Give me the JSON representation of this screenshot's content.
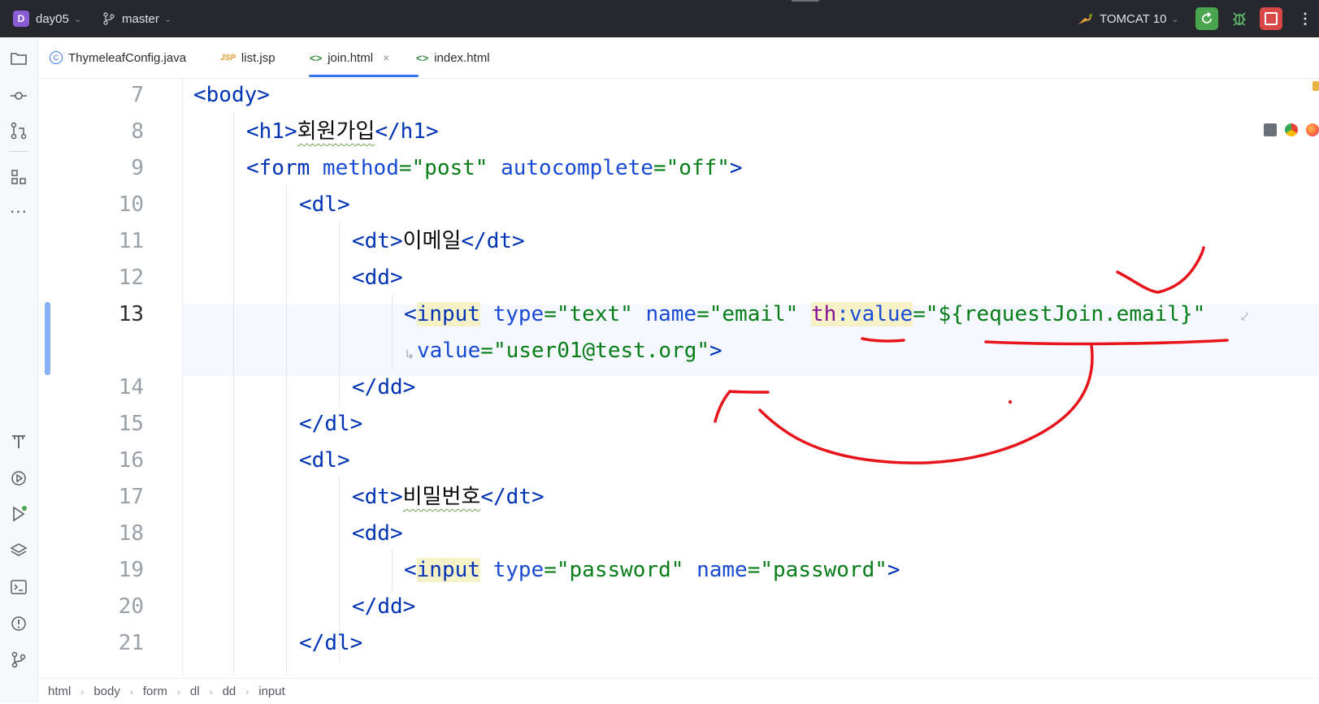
{
  "titlebar": {
    "project_badge": "D",
    "project_name": "day05",
    "branch": "master",
    "run_config": "TOMCAT 10",
    "colors": {
      "background": "#27282e",
      "run_green": "#4aa54f",
      "stop_red": "#d94848"
    }
  },
  "tabs": [
    {
      "label": "ThymeleafConfig.java",
      "icon": "java-class-icon"
    },
    {
      "label": "list.jsp",
      "icon": "jsp-file-icon",
      "icon_text": "JSP"
    },
    {
      "label": "join.html",
      "icon": "html-file-icon",
      "icon_text": "<>",
      "active": true,
      "close": "×"
    },
    {
      "label": "index.html",
      "icon": "html-file-icon",
      "icon_text": "<>"
    }
  ],
  "editor": {
    "current_line": 13,
    "lines": [
      {
        "number": "7"
      },
      {
        "number": "8"
      },
      {
        "number": "9"
      },
      {
        "number": "10"
      },
      {
        "number": "11"
      },
      {
        "number": "12"
      },
      {
        "number": "13"
      },
      {
        "number": ""
      },
      {
        "number": "14"
      },
      {
        "number": "15"
      },
      {
        "number": "16"
      },
      {
        "number": "17"
      },
      {
        "number": "18"
      },
      {
        "number": "19"
      },
      {
        "number": "20"
      },
      {
        "number": "21"
      }
    ],
    "code": {
      "l7_open": "<",
      "l7_tag": "body",
      "l7_close": ">",
      "l8_open": "<",
      "l8_tag": "h1",
      "l8_gt": ">",
      "l8_text": "회원가입",
      "l8_end_open": "</",
      "l8_end_tag": "h1",
      "l8_end_close": ">",
      "l9_open": "<",
      "l9_tag": "form",
      "l9_a1": " method",
      "l9_eq1": "=",
      "l9_v1": "\"post\"",
      "l9_a2": " autocomplete",
      "l9_eq2": "=",
      "l9_v2": "\"off\"",
      "l9_close": ">",
      "l10_open": "<",
      "l10_tag": "dl",
      "l10_close": ">",
      "l11_open": "<",
      "l11_tag": "dt",
      "l11_gt": ">",
      "l11_text": "이메일",
      "l11_end_open": "</",
      "l11_end_tag": "dt",
      "l11_end_close": ">",
      "l12_open": "<",
      "l12_tag": "dd",
      "l12_close": ">",
      "l13_open": "<",
      "l13_tag": "input",
      "l13_a1": " type",
      "l13_eq1": "=",
      "l13_v1": "\"text\"",
      "l13_a2": " name",
      "l13_eq2": "=",
      "l13_v2": "\"email\"",
      "l13_sp": " ",
      "l13_th": "th",
      "l13_colon": ":",
      "l13_a3": "value",
      "l13_eq3": "=",
      "l13_v3": "\"${requestJoin.email}\"",
      "l13b_a": "value",
      "l13b_eq": "=",
      "l13b_v": "\"user01@test.org\"",
      "l13b_close": ">",
      "l14_open": "</",
      "l14_tag": "dd",
      "l14_close": ">",
      "l15_open": "</",
      "l15_tag": "dl",
      "l15_close": ">",
      "l16_open": "<",
      "l16_tag": "dl",
      "l16_close": ">",
      "l17_open": "<",
      "l17_tag": "dt",
      "l17_gt": ">",
      "l17_text": "비밀번호",
      "l17_end_open": "</",
      "l17_end_tag": "dt",
      "l17_end_close": ">",
      "l18_open": "<",
      "l18_tag": "dd",
      "l18_close": ">",
      "l19_open": "<",
      "l19_tag": "input",
      "l19_a1": " type",
      "l19_eq1": "=",
      "l19_v1": "\"password\"",
      "l19_a2": " name",
      "l19_eq2": "=",
      "l19_v2": "\"password\"",
      "l19_close": ">",
      "l20_open": "</",
      "l20_tag": "dd",
      "l20_close": ">",
      "l21_open": "</",
      "l21_tag": "dl",
      "l21_close": ">"
    },
    "syntax_colors": {
      "tag": "#0033b3",
      "attribute": "#174ad4",
      "string": "#067d17",
      "namespace": "#871094",
      "line_number": "#9aa0a8"
    }
  },
  "breadcrumb": [
    "html",
    "body",
    "form",
    "dl",
    "dd",
    "input"
  ],
  "annotation": {
    "color": "#e8141b",
    "description_icons": "check-mark, underlines, arrow"
  }
}
